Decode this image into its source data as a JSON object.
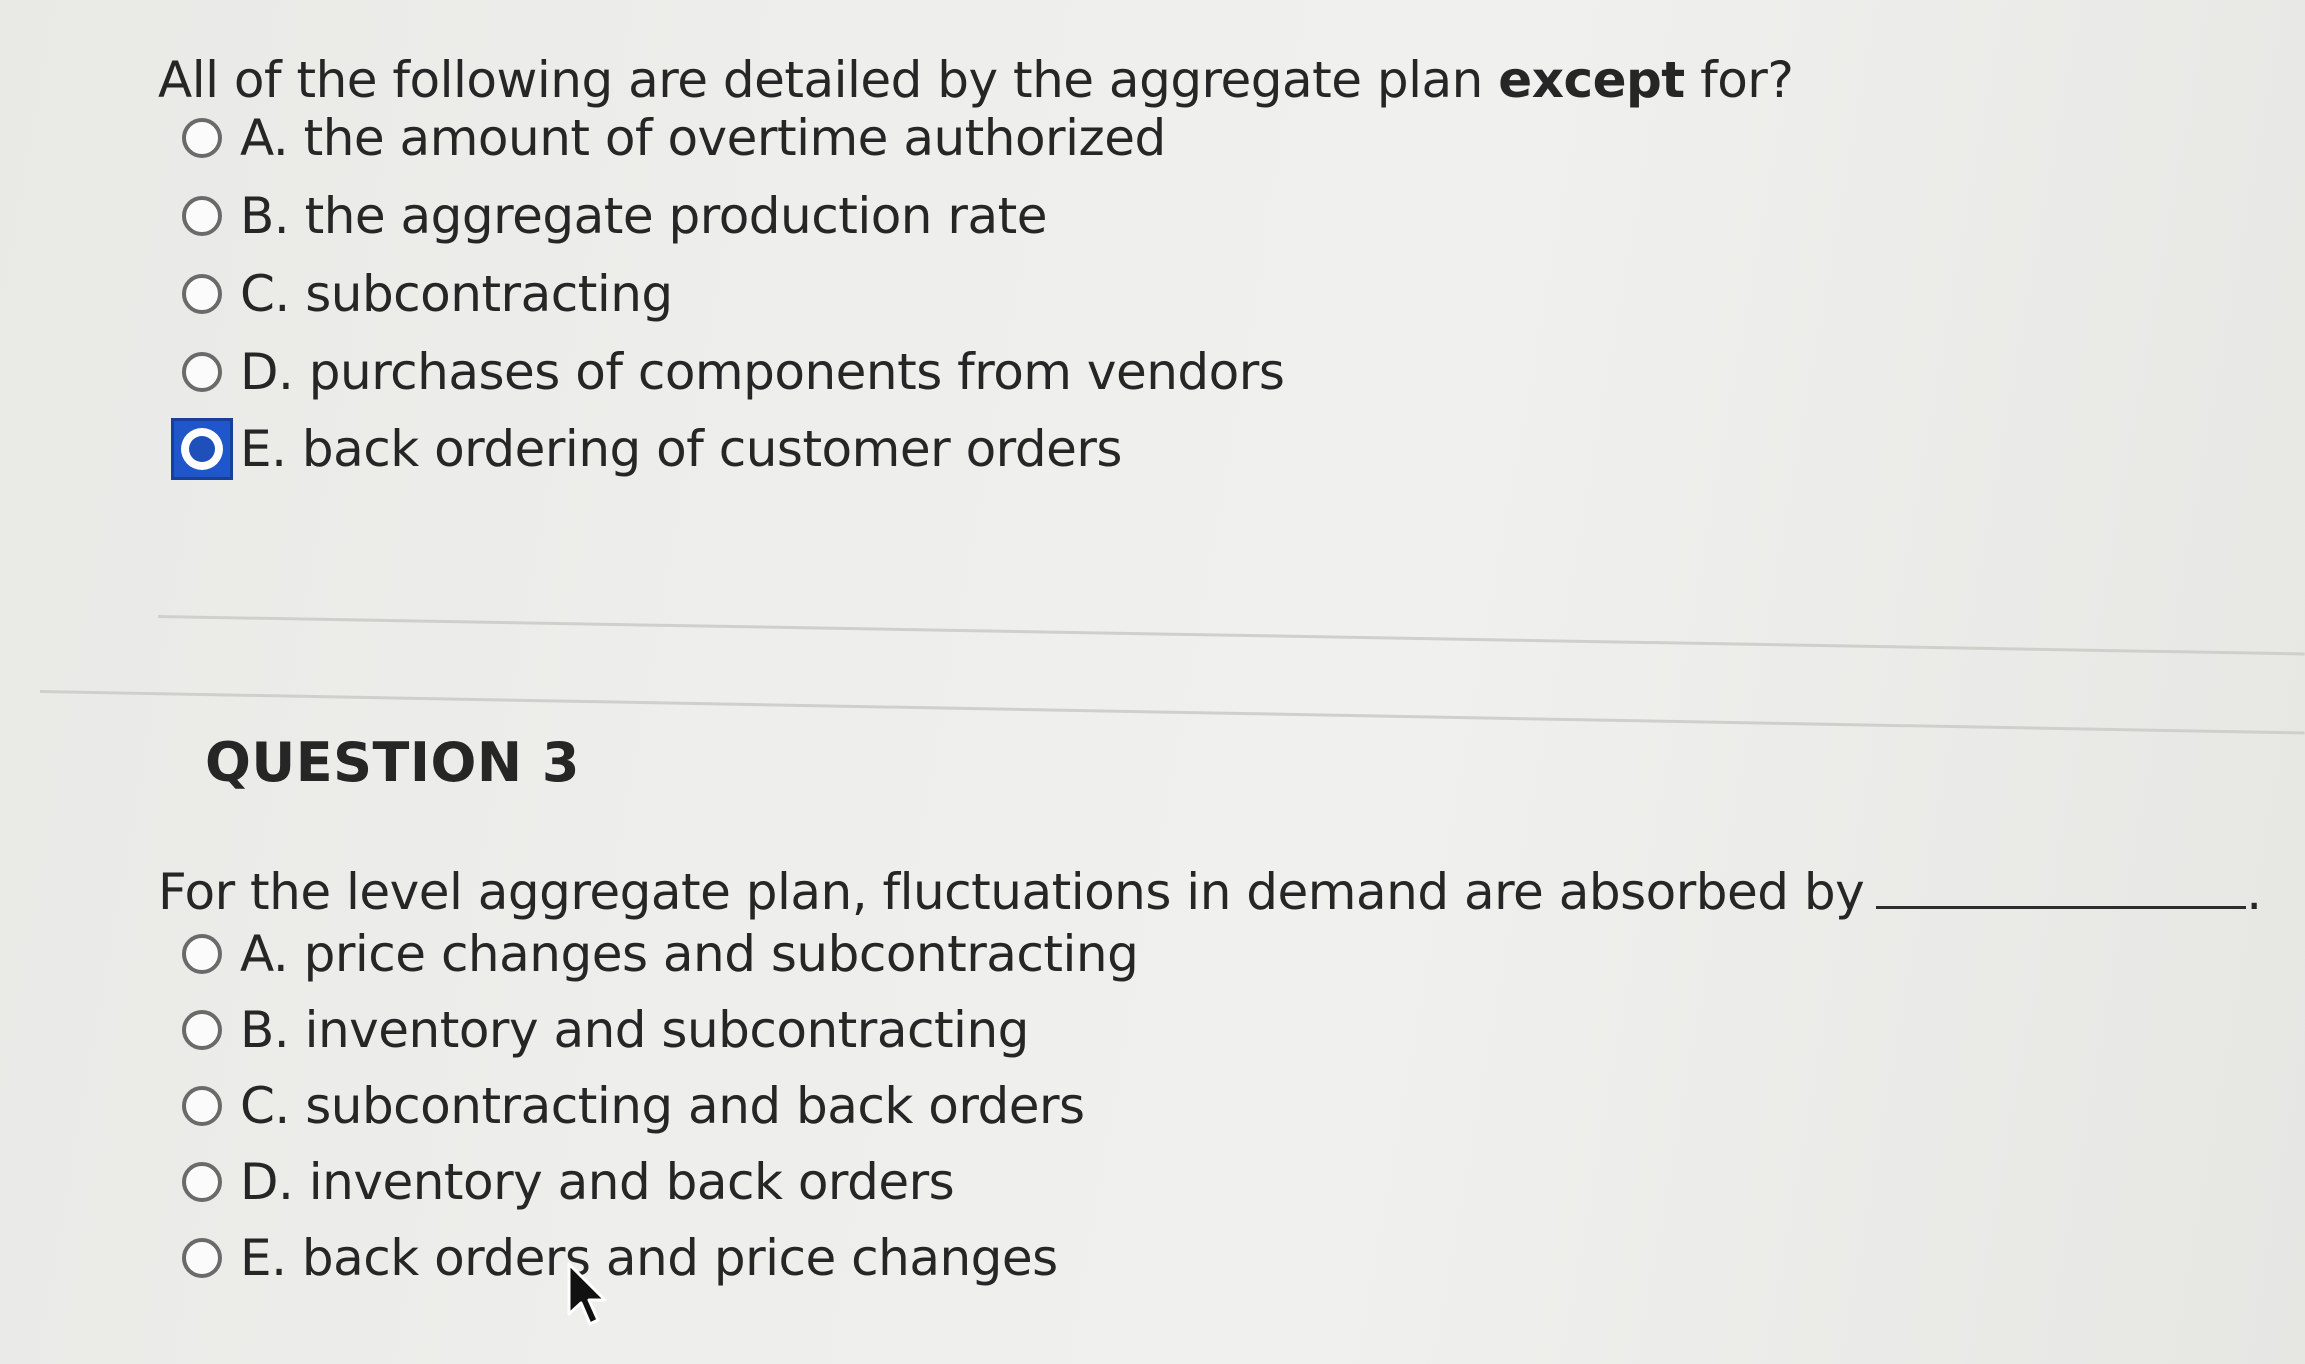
{
  "question2": {
    "stem_prefix": "All of the following are detailed by the aggregate plan",
    "stem_bold": "except",
    "stem_suffix": "for?",
    "options": [
      {
        "label": "A. the amount of overtime authorized",
        "selected": false
      },
      {
        "label": "B. the aggregate production rate",
        "selected": false
      },
      {
        "label": "C. subcontracting",
        "selected": false
      },
      {
        "label": "D. purchases of components from vendors",
        "selected": false
      },
      {
        "label": "E. back ordering of customer orders",
        "selected": true
      }
    ]
  },
  "question3": {
    "heading": "QUESTION 3",
    "stem": "For the level aggregate plan, fluctuations in demand are absorbed by",
    "stem_end": ".",
    "options": [
      {
        "label": "A. price changes and subcontracting",
        "selected": false
      },
      {
        "label": "B. inventory and subcontracting",
        "selected": false
      },
      {
        "label": "C. subcontracting and back orders",
        "selected": false
      },
      {
        "label": "D. inventory and back orders",
        "selected": false
      },
      {
        "label": "E. back orders and price changes",
        "selected": false
      }
    ]
  },
  "colors": {
    "selected_radio": "#1f56c9",
    "text": "#262626"
  },
  "icons": {
    "cursor": "mouse-pointer-icon"
  }
}
